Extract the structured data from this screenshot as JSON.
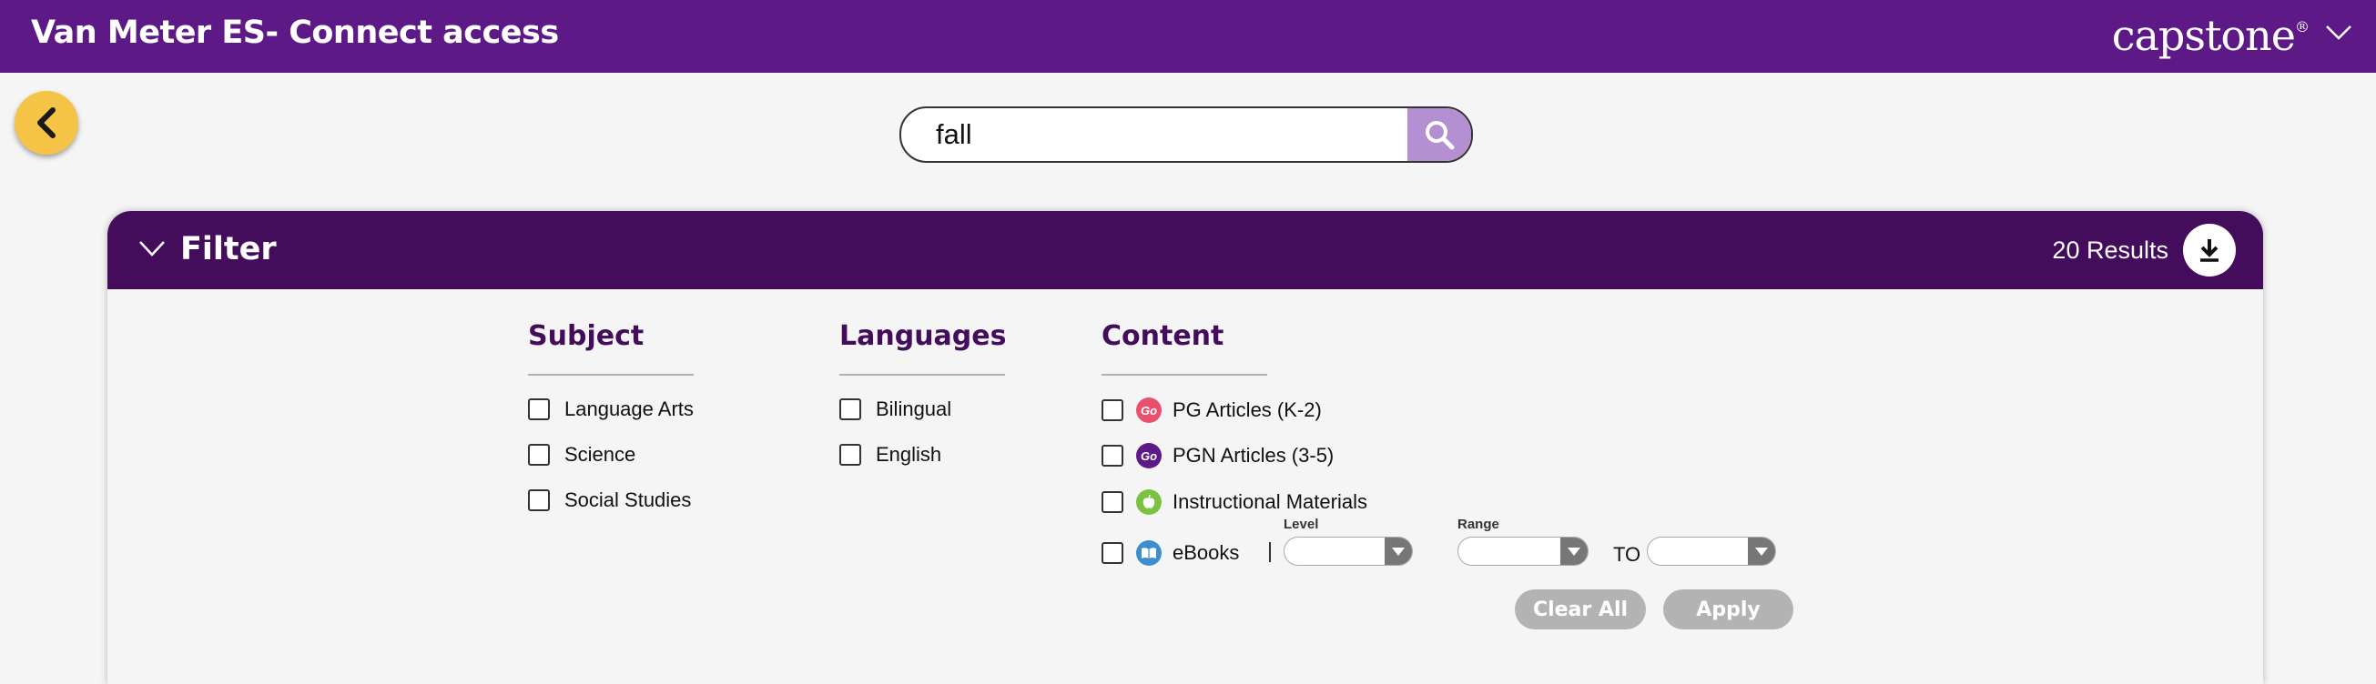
{
  "header": {
    "title": "Van Meter ES- Connect access",
    "brand": "capstone",
    "brand_mark": "®"
  },
  "search": {
    "value": "fall",
    "placeholder": ""
  },
  "filter": {
    "title": "Filter",
    "results": "20 Results"
  },
  "subject": {
    "title": "Subject",
    "options": [
      "Language Arts",
      "Science",
      "Social Studies"
    ]
  },
  "languages": {
    "title": "Languages",
    "options": [
      "Bilingual",
      "English"
    ]
  },
  "content": {
    "title": "Content",
    "options": [
      "PG Articles (K-2)",
      "PGN Articles (3-5)",
      "Instructional Materials",
      "eBooks"
    ],
    "badges": {
      "pg": "Go",
      "pgn": "Go"
    }
  },
  "ebooks_filters": {
    "level_label": "Level",
    "range_label": "Range",
    "to_label": "TO"
  },
  "buttons": {
    "clear_all": "Clear All",
    "apply": "Apply"
  },
  "colors": {
    "topbar": "#5d1a87",
    "filter_header": "#430d5c",
    "search_button": "#b48fd1",
    "back_button": "#f5c447",
    "pg_badge": "#e8506d",
    "pgn_badge": "#5d1a87",
    "instructional_badge": "#7bc242",
    "ebooks_badge": "#3b8fd0"
  },
  "icons": {
    "back": "chevron-left-icon",
    "search": "search-icon",
    "download": "download-icon",
    "brand_menu": "chevron-down-icon",
    "filter_toggle": "chevron-down-icon"
  }
}
